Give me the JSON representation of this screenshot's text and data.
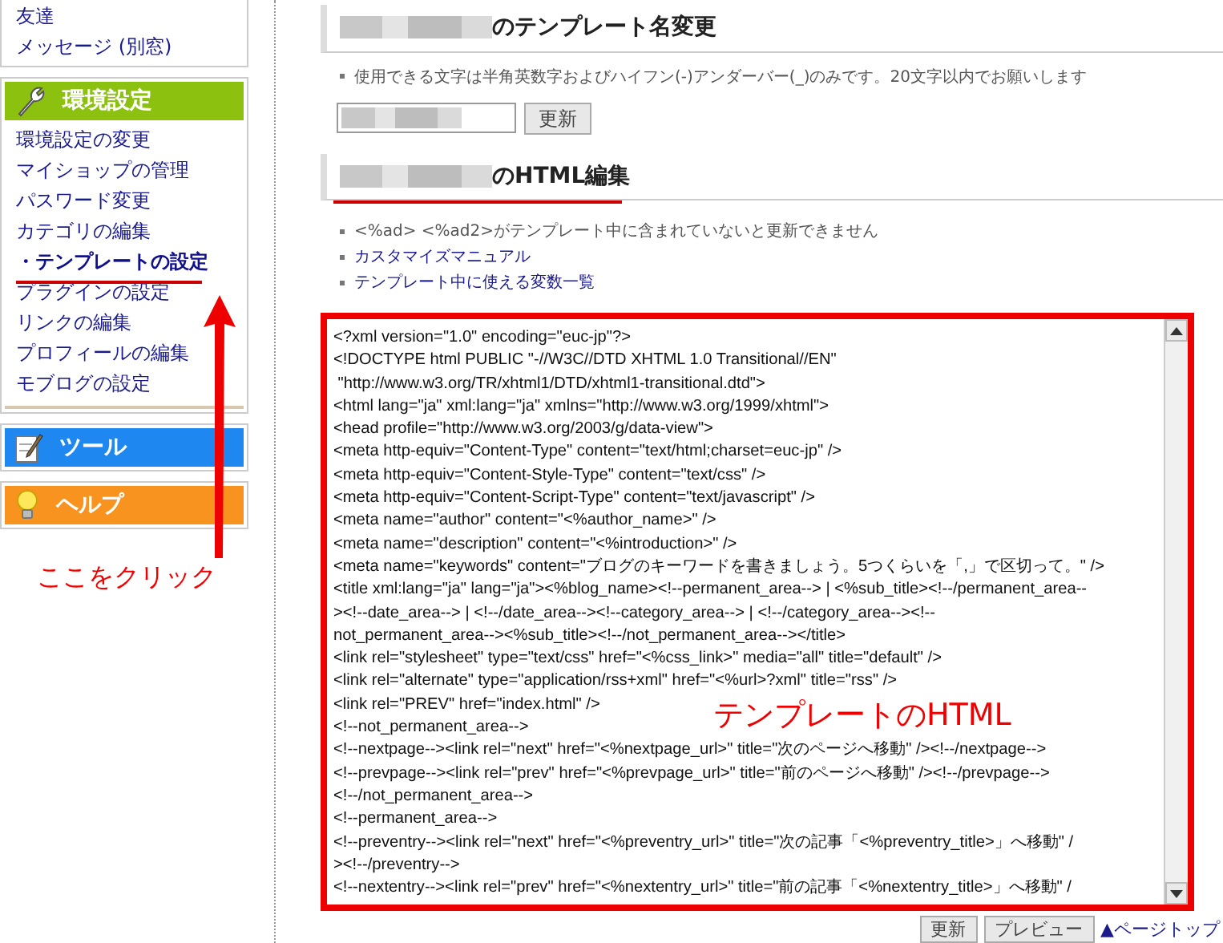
{
  "sidebar": {
    "top_links": [
      {
        "label": "友達"
      },
      {
        "label": "メッセージ (別窓)"
      }
    ],
    "sections": [
      {
        "kind": "settings",
        "title": "環境設定",
        "color": "#8cc10f",
        "items": [
          {
            "label": "環境設定の変更",
            "selected": false
          },
          {
            "label": "マイショップの管理",
            "selected": false
          },
          {
            "label": "パスワード変更",
            "selected": false
          },
          {
            "label": "カテゴリの編集",
            "selected": false
          },
          {
            "label": "・テンプレートの設定",
            "selected": true
          },
          {
            "label": "プラグインの設定",
            "selected": false
          },
          {
            "label": "リンクの編集",
            "selected": false
          },
          {
            "label": "プロフィールの編集",
            "selected": false
          },
          {
            "label": "モブログの設定",
            "selected": false
          }
        ]
      },
      {
        "kind": "tools",
        "title": "ツール",
        "color": "#1e87f0"
      },
      {
        "kind": "help",
        "title": "ヘルプ",
        "color": "#f7931e"
      }
    ]
  },
  "rename_section": {
    "title": "のテンプレート名変更",
    "note": "使用できる文字は半角英数字およびハイフン(-)アンダーバー(_)のみです。20文字以内でお願いします",
    "button": "更新"
  },
  "html_section": {
    "title": "のHTML編集",
    "notes": [
      {
        "kind": "note",
        "text": "<%ad> <%ad2>がテンプレート中に含まれていないと更新できません"
      },
      {
        "kind": "link",
        "text": "カスタマイズマニュアル"
      },
      {
        "kind": "link",
        "text": "テンプレート中に使える変数一覧"
      }
    ],
    "code_lines": [
      "<?xml version=\"1.0\" encoding=\"euc-jp\"?>",
      "<!DOCTYPE html PUBLIC \"-//W3C//DTD XHTML 1.0 Transitional//EN\"",
      " \"http://www.w3.org/TR/xhtml1/DTD/xhtml1-transitional.dtd\">",
      "<html lang=\"ja\" xml:lang=\"ja\" xmlns=\"http://www.w3.org/1999/xhtml\">",
      "<head profile=\"http://www.w3.org/2003/g/data-view\">",
      "<meta http-equiv=\"Content-Type\" content=\"text/html;charset=euc-jp\" />",
      "<meta http-equiv=\"Content-Style-Type\" content=\"text/css\" />",
      "<meta http-equiv=\"Content-Script-Type\" content=\"text/javascript\" />",
      "<meta name=\"author\" content=\"<%author_name>\" />",
      "<meta name=\"description\" content=\"<%introduction>\" />",
      "<meta name=\"keywords\" content=\"ブログのキーワードを書きましょう。5つくらいを「,」で区切って。\" />",
      "<title xml:lang=\"ja\" lang=\"ja\"><%blog_name><!--permanent_area--> | <%sub_title><!--/permanent_area--",
      "><!--date_area--> | <!--/date_area--><!--category_area--> | <!--/category_area--><!--",
      "not_permanent_area--><%sub_title><!--/not_permanent_area--></title>",
      "<link rel=\"stylesheet\" type=\"text/css\" href=\"<%css_link>\" media=\"all\" title=\"default\" />",
      "<link rel=\"alternate\" type=\"application/rss+xml\" href=\"<%url>?xml\" title=\"rss\" />",
      "<link rel=\"PREV\" href=\"index.html\" />",
      "<!--not_permanent_area-->",
      "<!--nextpage--><link rel=\"next\" href=\"<%nextpage_url>\" title=\"次のページへ移動\" /><!--/nextpage-->",
      "<!--prevpage--><link rel=\"prev\" href=\"<%prevpage_url>\" title=\"前のページへ移動\" /><!--/prevpage-->",
      "<!--/not_permanent_area-->",
      "<!--permanent_area-->",
      "<!--preventry--><link rel=\"next\" href=\"<%preventry_url>\" title=\"次の記事「<%preventry_title>」へ移動\" /",
      "><!--/preventry-->",
      "<!--nextentry--><link rel=\"prev\" href=\"<%nextentry_url>\" title=\"前の記事「<%nextentry_title>」へ移動\" /"
    ],
    "buttons": [
      "更新",
      "プレビュー"
    ],
    "page_top_link": "▲ページトップ"
  },
  "annotations": {
    "click_label": "ここをクリック",
    "overlay_label": "テンプレートのHTML"
  }
}
